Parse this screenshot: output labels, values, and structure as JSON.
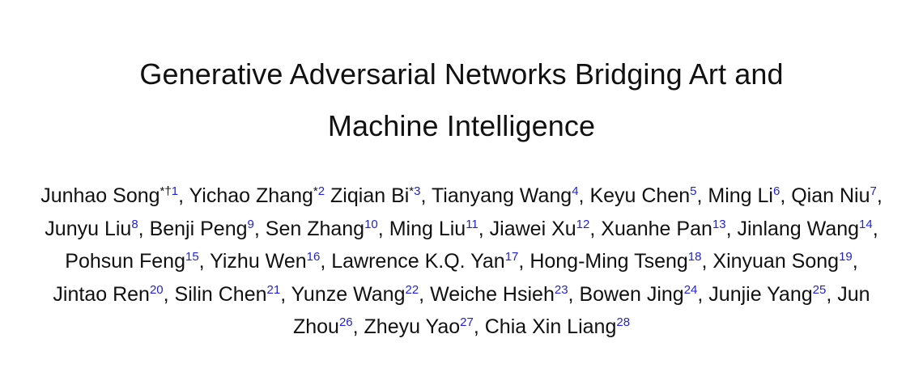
{
  "paper": {
    "title_lines": [
      "Generative Adversarial Networks Bridging Art and",
      "Machine Intelligence"
    ],
    "authors": [
      {
        "name": "Junhao Song",
        "marks": "*†",
        "aff": "1",
        "sep": ", "
      },
      {
        "name": "Yichao Zhang",
        "marks": "*",
        "aff": "2",
        "sep": " "
      },
      {
        "name": "Ziqian Bi",
        "marks": "*",
        "aff": "3",
        "sep": ", "
      },
      {
        "name": "Tianyang Wang",
        "marks": "",
        "aff": "4",
        "sep": ", "
      },
      {
        "name": "Keyu Chen",
        "marks": "",
        "aff": "5",
        "sep": ", "
      },
      {
        "name": "Ming Li",
        "marks": "",
        "aff": "6",
        "sep": ", "
      },
      {
        "name": "Qian Niu",
        "marks": "",
        "aff": "7",
        "sep": ", "
      },
      {
        "name": "Junyu Liu",
        "marks": "",
        "aff": "8",
        "sep": ", "
      },
      {
        "name": "Benji Peng",
        "marks": "",
        "aff": "9",
        "sep": ", "
      },
      {
        "name": "Sen Zhang",
        "marks": "",
        "aff": "10",
        "sep": ", "
      },
      {
        "name": "Ming Liu",
        "marks": "",
        "aff": "11",
        "sep": ", "
      },
      {
        "name": "Jiawei Xu",
        "marks": "",
        "aff": "12",
        "sep": ", "
      },
      {
        "name": "Xuanhe Pan",
        "marks": "",
        "aff": "13",
        "sep": ", "
      },
      {
        "name": "Jinlang Wang",
        "marks": "",
        "aff": "14",
        "sep": ", "
      },
      {
        "name": "Pohsun Feng",
        "marks": "",
        "aff": "15",
        "sep": ", "
      },
      {
        "name": "Yizhu Wen",
        "marks": "",
        "aff": "16",
        "sep": ", "
      },
      {
        "name": "Lawrence K.Q. Yan",
        "marks": "",
        "aff": "17",
        "sep": ", "
      },
      {
        "name": "Hong-Ming Tseng",
        "marks": "",
        "aff": "18",
        "sep": ", "
      },
      {
        "name": "Xinyuan Song",
        "marks": "",
        "aff": "19",
        "sep": ", "
      },
      {
        "name": "Jintao Ren",
        "marks": "",
        "aff": "20",
        "sep": ", "
      },
      {
        "name": "Silin Chen",
        "marks": "",
        "aff": "21",
        "sep": ", "
      },
      {
        "name": "Yunze Wang",
        "marks": "",
        "aff": "22",
        "sep": ", "
      },
      {
        "name": "Weiche Hsieh",
        "marks": "",
        "aff": "23",
        "sep": ", "
      },
      {
        "name": "Bowen Jing",
        "marks": "",
        "aff": "24",
        "sep": ", "
      },
      {
        "name": "Junjie Yang",
        "marks": "",
        "aff": "25",
        "sep": ", "
      },
      {
        "name": "Jun Zhou",
        "marks": "",
        "aff": "26",
        "sep": ", "
      },
      {
        "name": "Zheyu Yao",
        "marks": "",
        "aff": "27",
        "sep": ", "
      },
      {
        "name": "Chia Xin Liang",
        "marks": "",
        "aff": "28",
        "sep": ""
      }
    ]
  },
  "colors": {
    "text": "#111111",
    "affiliation_link": "#1f1fe0",
    "background": "#ffffff"
  }
}
